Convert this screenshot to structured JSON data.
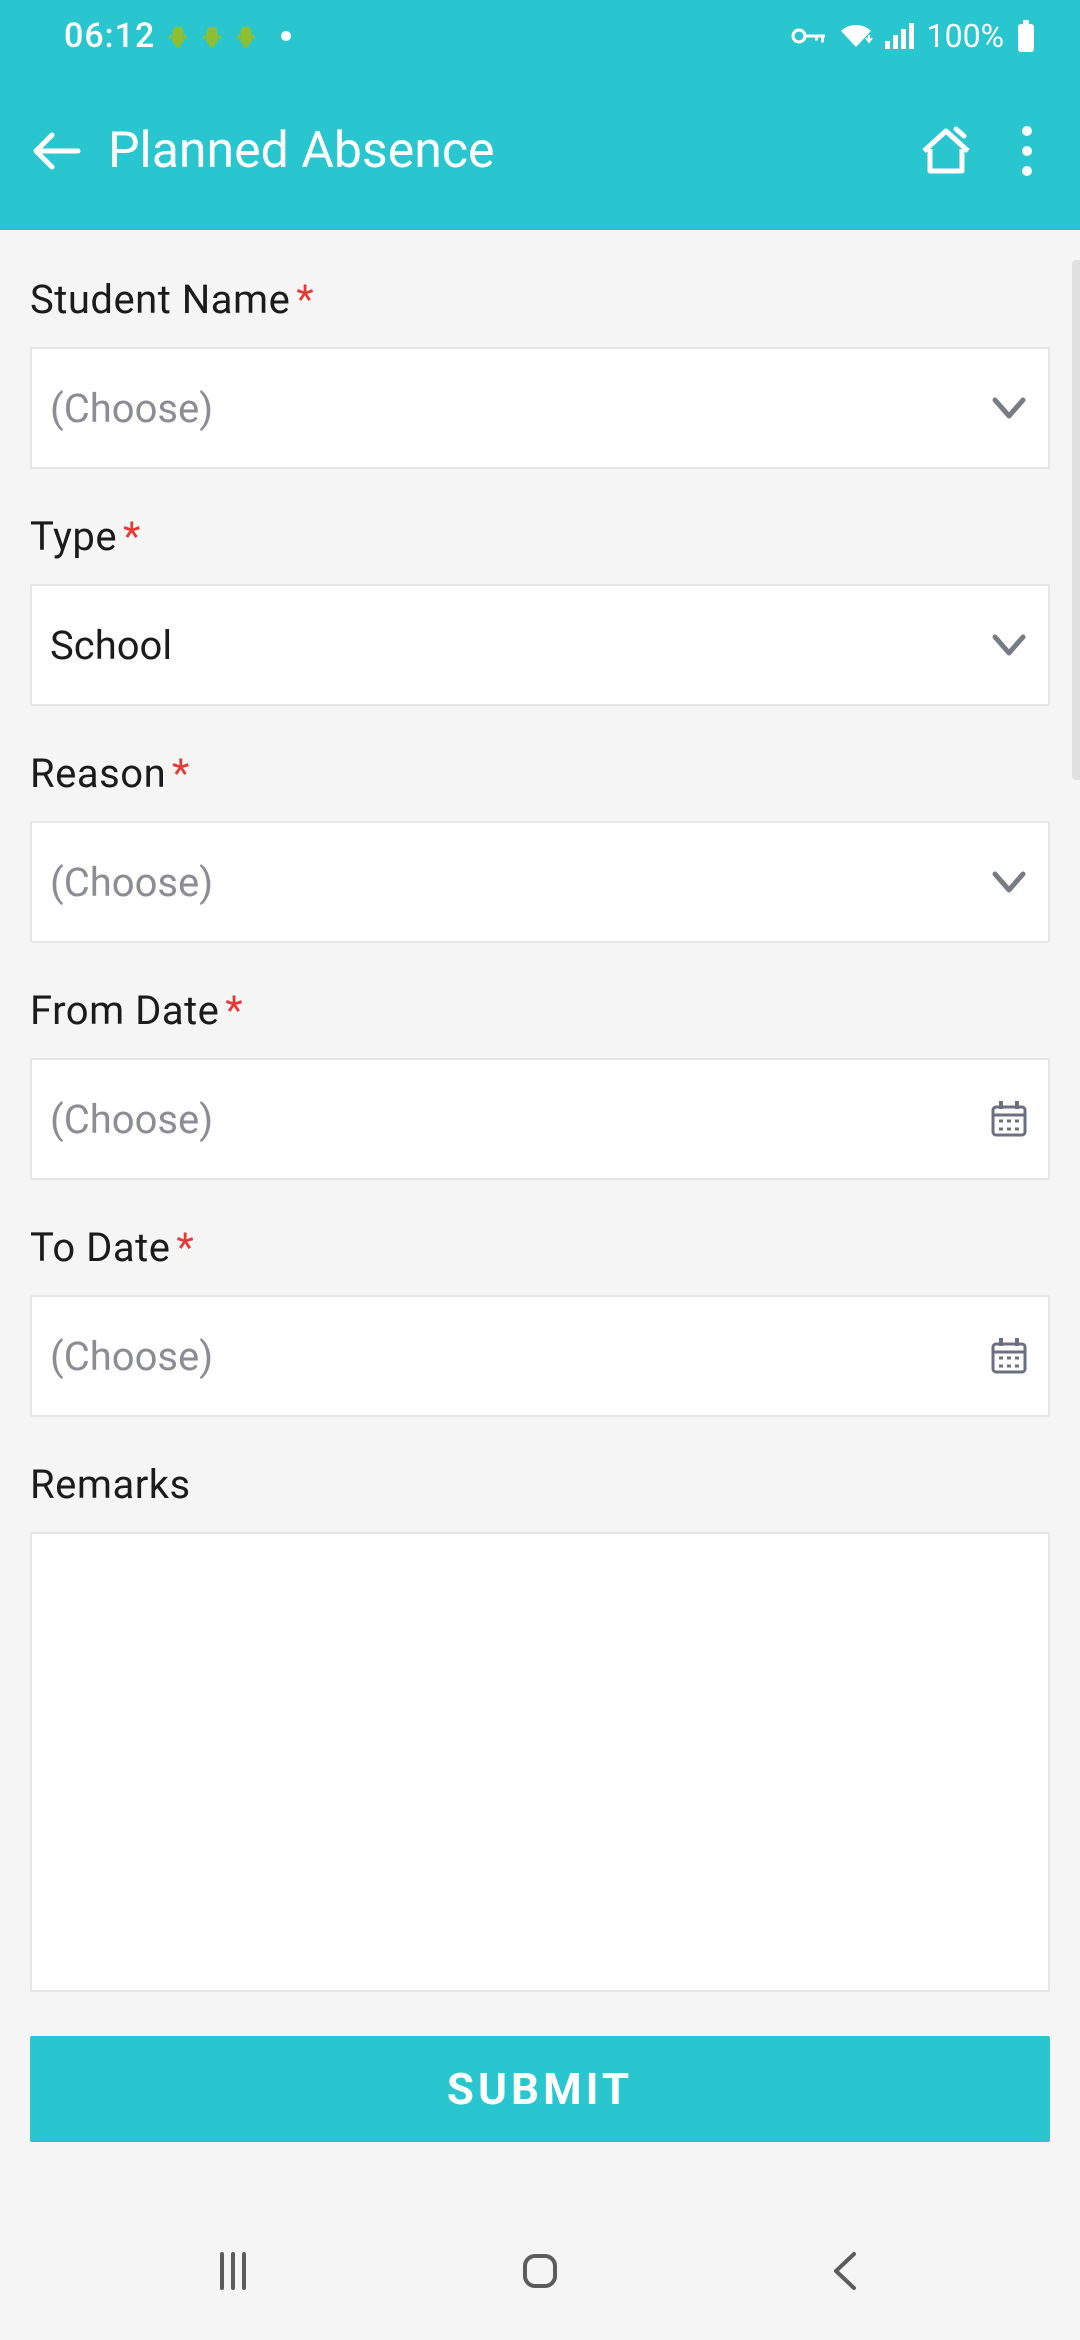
{
  "status": {
    "time": "06:12",
    "battery": "100%"
  },
  "header": {
    "title": "Planned Absence"
  },
  "form": {
    "student_name": {
      "label": "Student Name",
      "required": true,
      "value": "(Choose)",
      "placeholder": true
    },
    "type": {
      "label": "Type",
      "required": true,
      "value": "School",
      "placeholder": false
    },
    "reason": {
      "label": "Reason",
      "required": true,
      "value": "(Choose)",
      "placeholder": true
    },
    "from_date": {
      "label": "From Date",
      "required": true,
      "value": "(Choose)",
      "placeholder": true
    },
    "to_date": {
      "label": "To Date",
      "required": true,
      "value": "(Choose)",
      "placeholder": true
    },
    "remarks": {
      "label": "Remarks",
      "required": false,
      "value": ""
    }
  },
  "actions": {
    "submit_label": "SUBMIT"
  },
  "colors": {
    "accent": "#29c6cf",
    "required": "#e53935",
    "placeholder": "#8c8c94",
    "text": "#1b1b1b",
    "border": "#e6e6e6"
  }
}
